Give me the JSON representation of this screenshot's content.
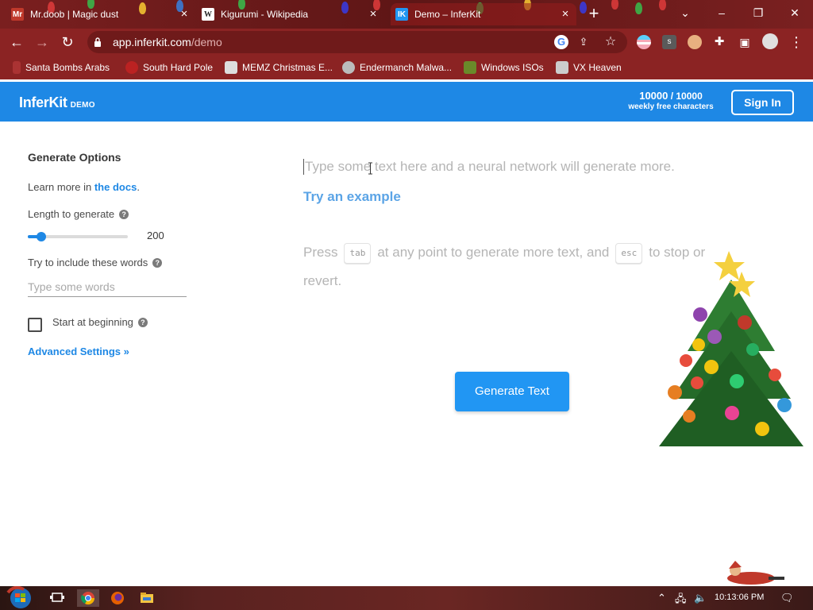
{
  "browser": {
    "tabs": [
      {
        "title": "Mr.doob | Magic dust",
        "favicon": "Mr"
      },
      {
        "title": "Kigurumi - Wikipedia",
        "favicon": "W"
      },
      {
        "title": "Demo – InferKit",
        "favicon": "IK"
      }
    ],
    "url_host": "app.inferkit.com",
    "url_path": "/demo",
    "bookmarks": [
      {
        "label": "Santa Bombs Arabs"
      },
      {
        "label": "South Hard Pole"
      },
      {
        "label": "MEMZ Christmas E..."
      },
      {
        "label": "Endermanch Malwa..."
      },
      {
        "label": "Windows ISOs"
      },
      {
        "label": "VX Heaven"
      }
    ]
  },
  "header": {
    "logo": "InferKit",
    "logo_badge": "DEMO",
    "quota_used": "10000",
    "quota_total": "/ 10000",
    "quota_caption": "weekly free characters",
    "signin_label": "Sign In"
  },
  "options": {
    "title": "Generate Options",
    "learn_prefix": "Learn more in",
    "docs_link": "the docs",
    "learn_suffix": ".",
    "length_label": "Length to generate",
    "length_value": "200",
    "length_fraction": 0.1,
    "include_label": "Try to include these words",
    "include_placeholder": "Type some words",
    "start_label": "Start at beginning",
    "advanced_label": "Advanced Settings »"
  },
  "editor": {
    "placeholder": "Type some text here and a neural network will generate more.",
    "try_example": "Try an example",
    "help_press": "Press",
    "help_key_tab": "tab",
    "help_middle": "at any point to generate more text, and",
    "help_key_esc": "esc",
    "help_end": "to stop or revert.",
    "generate_label": "Generate Text"
  },
  "taskbar": {
    "clock": "10:13:06 PM"
  },
  "colors": {
    "brand": "#1e88e5",
    "button": "#2196f3",
    "chrome": "#8b2323"
  }
}
